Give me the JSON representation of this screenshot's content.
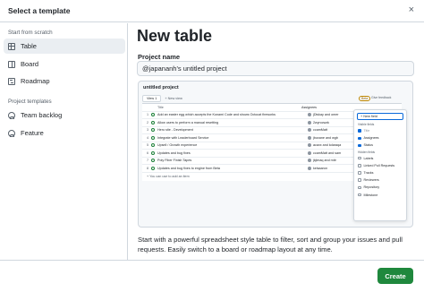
{
  "dialog": {
    "title": "Select a template",
    "close_glyph": "×",
    "create_label": "Create",
    "create_color": "#1f883d"
  },
  "sidebar": {
    "scratch_heading": "Start from scratch",
    "scratch_items": [
      {
        "label": "Table",
        "icon": "table-icon",
        "active": true
      },
      {
        "label": "Board",
        "icon": "board-icon",
        "active": false
      },
      {
        "label": "Roadmap",
        "icon": "roadmap-icon",
        "active": false
      }
    ],
    "templates_heading": "Project templates",
    "template_items": [
      {
        "label": "Team backlog",
        "icon": "person-icon"
      },
      {
        "label": "Feature",
        "icon": "person-icon"
      }
    ]
  },
  "main": {
    "title": "New table",
    "name_label": "Project name",
    "name_value": "@japananh's untitled project",
    "description": "Start with a powerful spreadsheet style table to filter, sort and group your issues and pull requests. Easily switch to a board or roadmap layout at any time."
  },
  "preview": {
    "title": "untitled project",
    "view_tab": "View 1",
    "new_view": "+ New view",
    "beta_badge": "Beta",
    "feedback": "Give feedback",
    "columns": {
      "title": "Title",
      "assignees": "Assignees"
    },
    "rows": [
      {
        "num": "1",
        "title": "Add an easter egg which accepts the Konami Code and shows Octocat fireworks",
        "assignee": "jDiskay and omer"
      },
      {
        "num": "2",
        "title": "Allow users to perform a manual resetting",
        "assignee": "2wyrocwzk"
      },
      {
        "num": "3",
        "title": "Hero site - Development",
        "assignee": "ccamMatt"
      },
      {
        "num": "4",
        "title": "Integrate with Leaderboard Service",
        "assignee": "jbuxane and wgb"
      },
      {
        "num": "5",
        "title": "Upsell / Growth experience",
        "assignee": "acaxx and kdaraqa"
      },
      {
        "num": "6",
        "title": "Updates and bug fixes",
        "assignee": "ccamMatt and sam"
      },
      {
        "num": "7",
        "title": "Poly Fiber Finish Tapes",
        "assignee": "jkjimaq and mitr"
      },
      {
        "num": "8",
        "title": "Updates and bug fixes to engine from Beta",
        "assignee": "keisaaron"
      }
    ],
    "add_row": "+ You can use  to add an item",
    "menu": {
      "new_field": "+ New field",
      "visible_heading": "Visible fields",
      "visible_fields": [
        {
          "label": "Title",
          "checked": true,
          "disabled": true
        },
        {
          "label": "Assignees",
          "checked": true,
          "disabled": false
        },
        {
          "label": "Status",
          "checked": true,
          "disabled": false
        }
      ],
      "hidden_heading": "Hidden fields",
      "hidden_fields": [
        {
          "label": "Labels"
        },
        {
          "label": "Linked Pull Requests"
        },
        {
          "label": "Tracks"
        },
        {
          "label": "Reviewers"
        },
        {
          "label": "Repository"
        },
        {
          "label": "Milestone"
        }
      ]
    }
  }
}
